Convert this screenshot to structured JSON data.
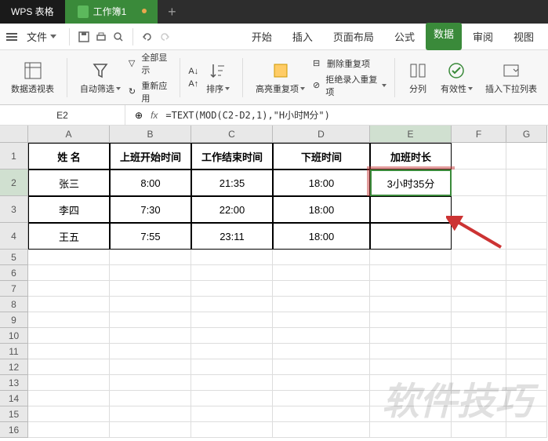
{
  "app": {
    "name": "WPS 表格",
    "tab_title": "工作簿1",
    "add_tab": "+"
  },
  "menu": {
    "file": "文件",
    "tabs": [
      "开始",
      "插入",
      "页面布局",
      "公式",
      "数据",
      "审阅",
      "视图"
    ],
    "active_index": 4
  },
  "toolbar": {
    "pivot": "数据透视表",
    "autofilter": "自动筛选",
    "show_all": "全部显示",
    "reapply": "重新应用",
    "sort": "排序",
    "highlight_dup": "高亮重复项",
    "del_dup": "删除重复项",
    "reject_dup": "拒绝录入重复项",
    "split": "分列",
    "validation": "有效性",
    "insert_dropdown": "插入下拉列表"
  },
  "namebox": {
    "ref": "E2"
  },
  "formula_bar": {
    "fx": "fx",
    "text": "=TEXT(MOD(C2-D2,1),\"H小时M分\")"
  },
  "columns": [
    "A",
    "B",
    "C",
    "D",
    "E",
    "F",
    "G"
  ],
  "rows": [
    1,
    2,
    3,
    4,
    5,
    6,
    7,
    8,
    9,
    10,
    11,
    12,
    13,
    14,
    15,
    16
  ],
  "row_heights": {
    "data": 34,
    "normal": 20
  },
  "selected_col": "E",
  "selected_row": 2,
  "table": {
    "headers": [
      "姓 名",
      "上班开始时间",
      "工作结束时间",
      "下班时间",
      "加班时长"
    ],
    "rows": [
      [
        "张三",
        "8:00",
        "21:35",
        "18:00",
        "3小时35分"
      ],
      [
        "李四",
        "7:30",
        "22:00",
        "18:00",
        ""
      ],
      [
        "王五",
        "7:55",
        "23:11",
        "18:00",
        ""
      ]
    ]
  },
  "watermark": "软件技巧"
}
